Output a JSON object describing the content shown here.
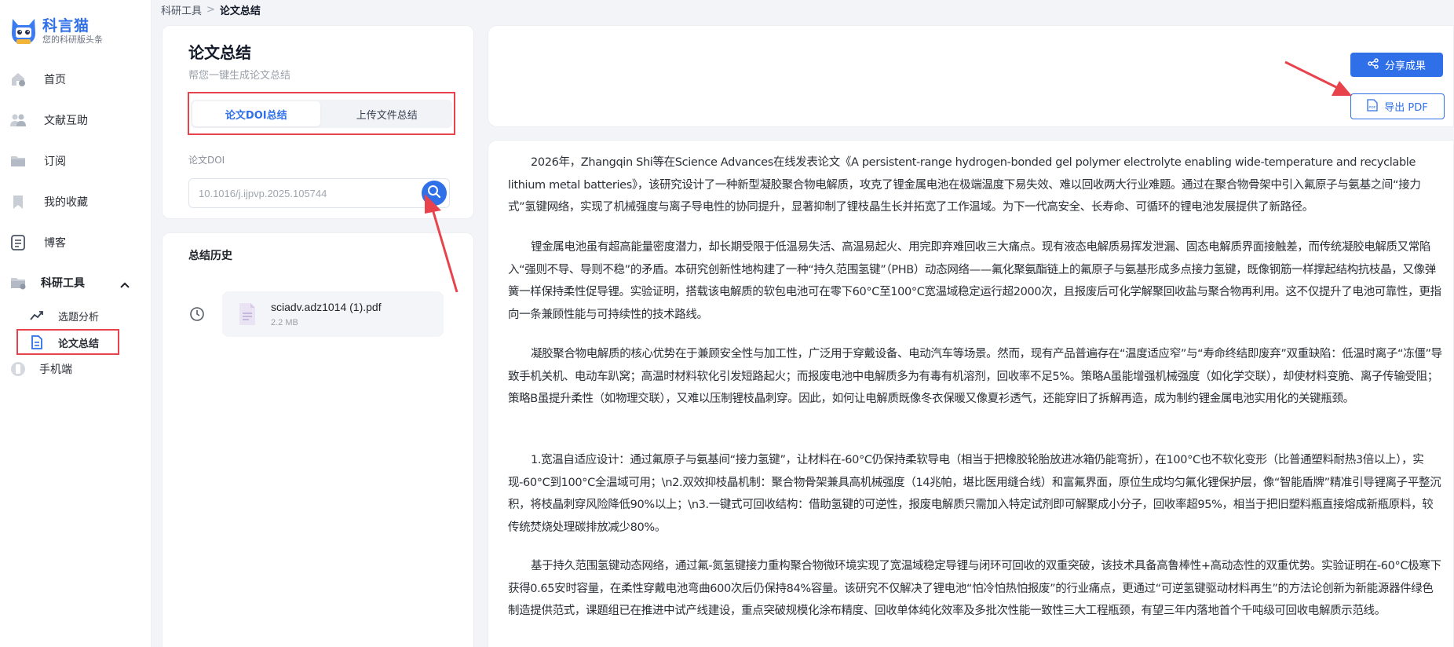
{
  "app": {
    "logo_title": "科言猫",
    "logo_subtitle": "您的科研版头条"
  },
  "sidebar": {
    "items": [
      {
        "label": "首页",
        "icon": "home-icon"
      },
      {
        "label": "文献互助",
        "icon": "people-icon"
      },
      {
        "label": "订阅",
        "icon": "folder-icon"
      },
      {
        "label": "我的收藏",
        "icon": "bookmark-icon"
      },
      {
        "label": "博客",
        "icon": "document-icon"
      }
    ],
    "group": {
      "label": "科研工具",
      "icon": "folder-icon",
      "expanded": true
    },
    "sub_items": [
      {
        "label": "选题分析",
        "icon": "trend-icon"
      },
      {
        "label": "论文总结",
        "icon": "file-icon",
        "active": true
      }
    ],
    "mobile": {
      "label": "手机端",
      "icon": "phone-icon"
    }
  },
  "breadcrumb": {
    "parent": "科研工具",
    "separator": ">",
    "current": "论文总结"
  },
  "summary_card": {
    "title": "论文总结",
    "subtitle": "帮您一键生成论文总结",
    "tabs": [
      {
        "label": "论文DOI总结",
        "active": true
      },
      {
        "label": "上传文件总结",
        "active": false
      }
    ],
    "field_label": "论文DOI",
    "doi_placeholder": "10.1016/j.ijpvp.2025.105744"
  },
  "history": {
    "title": "总结历史",
    "files": [
      {
        "name": "sciadv.adz1014 (1).pdf",
        "size": "2.2 MB"
      }
    ]
  },
  "actions": {
    "share_label": "分享成果",
    "export_label": "导出 PDF"
  },
  "colors": {
    "primary": "#2f6fe8",
    "annotation_red": "#e8434c"
  },
  "article": {
    "paragraphs": [
      "2026年，Zhangqin Shi等在Science Advances在线发表论文《A persistent-range hydrogen-bonded gel polymer electrolyte enabling wide-temperature and recyclable lithium metal batteries》，该研究设计了一种新型凝胶聚合物电解质，攻克了锂金属电池在极端温度下易失效、难以回收两大行业难题。通过在聚合物骨架中引入氟原子与氨基之间“接力式”氢键网络，实现了机械强度与离子导电性的协同提升，显著抑制了锂枝晶生长并拓宽了工作温域。为下一代高安全、长寿命、可循环的锂电池发展提供了新路径。",
      "锂金属电池虽有超高能量密度潜力，却长期受限于低温易失活、高温易起火、用完即弃难回收三大痛点。现有液态电解质易挥发泄漏、固态电解质界面接触差，而传统凝胶电解质又常陷入“强则不导、导则不稳”的矛盾。本研究创新性地构建了一种“持久范围氢键”（PHB）动态网络——氟化聚氨酯链上的氟原子与氨基形成多点接力氢键，既像钢筋一样撑起结构抗枝晶，又像弹簧一样保持柔性促导锂。实验证明，搭载该电解质的软包电池可在零下60°C至100°C宽温域稳定运行超2000次，且报废后可化学解聚回收盐与聚合物再利用。这不仅提升了电池可靠性，更指向一条兼顾性能与可持续性的技术路线。",
      "凝胶聚合物电解质的核心优势在于兼顾安全性与加工性，广泛用于穿戴设备、电动汽车等场景。然而，现有产品普遍存在“温度适应窄”与“寿命终结即废弃”双重缺陷：低温时离子“冻僵”导致手机关机、电动车趴窝；高温时材料软化引发短路起火；而报废电池中电解质多为有毒有机溶剂，回收率不足5%。策略A虽能增强机械强度（如化学交联），却使材料变脆、离子传输受阻；策略B虽提升柔性（如物理交联），又难以压制锂枝晶刺穿。因此，如何让电解质既像冬衣保暖又像夏衫透气，还能穿旧了拆解再造，成为制约锂金属电池实用化的关键瓶颈。",
      "1.宽温自适应设计：通过氟原子与氨基间“接力氢键”，让材料在-60°C仍保持柔软导电（相当于把橡胶轮胎放进冰箱仍能弯折），在100°C也不软化变形（比普通塑料耐热3倍以上），实现-60°C到100°C全温域可用；\\n2.双效抑枝晶机制：聚合物骨架兼具高机械强度（14兆帕，堪比医用缝合线）和富氟界面，原位生成均匀氟化锂保护层，像“智能盾牌”精准引导锂离子平整沉积，将枝晶刺穿风险降低90%以上；\\n3.一键式可回收结构：借助氢键的可逆性，报废电解质只需加入特定试剂即可解聚成小分子，回收率超95%，相当于把旧塑料瓶直接熔成新瓶原料，较传统焚烧处理碳排放减少80%。",
      "基于持久范围氢键动态网络，通过氟-氮氢键接力重构聚合物微环境实现了宽温域稳定导锂与闭环可回收的双重突破，该技术具备高鲁棒性+高动态性的双重优势。实验证明在-60°C极寒下获得0.65安时容量，在柔性穿戴电池弯曲600次后仍保持84%容量。该研究不仅解决了锂电池“怕冷怕热怕报废”的行业痛点，更通过“可逆氢键驱动材料再生”的方法论创新为新能源器件绿色制造提供范式，课题组已在推进中试产线建设，重点突破规模化涂布精度、回收单体纯化效率及多批次性能一致性三大工程瓶颈，有望三年内落地首个千吨级可回收电解质示范线。"
    ]
  }
}
